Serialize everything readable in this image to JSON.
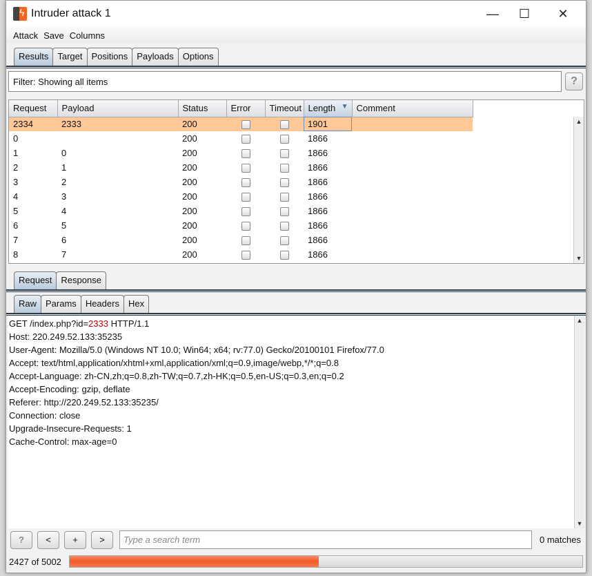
{
  "window": {
    "title": "Intruder attack 1",
    "minimize": "—",
    "maximize": "☐",
    "close": "✕"
  },
  "menu": [
    "Attack",
    "Save",
    "Columns"
  ],
  "tabs": [
    "Results",
    "Target",
    "Positions",
    "Payloads",
    "Options"
  ],
  "active_tab": "Results",
  "filter": "Filter: Showing all items",
  "help_label": "?",
  "table": {
    "columns": [
      "Request",
      "Payload",
      "Status",
      "Error",
      "Timeout",
      "Length",
      "Comment"
    ],
    "sorted_column": "Length",
    "rows": [
      [
        "2334",
        "2333",
        "200",
        false,
        false,
        "1901",
        ""
      ],
      [
        "0",
        "",
        "200",
        false,
        false,
        "1866",
        ""
      ],
      [
        "1",
        "0",
        "200",
        false,
        false,
        "1866",
        ""
      ],
      [
        "2",
        "1",
        "200",
        false,
        false,
        "1866",
        ""
      ],
      [
        "3",
        "2",
        "200",
        false,
        false,
        "1866",
        ""
      ],
      [
        "4",
        "3",
        "200",
        false,
        false,
        "1866",
        ""
      ],
      [
        "5",
        "4",
        "200",
        false,
        false,
        "1866",
        ""
      ],
      [
        "6",
        "5",
        "200",
        false,
        false,
        "1866",
        ""
      ],
      [
        "7",
        "6",
        "200",
        false,
        false,
        "1866",
        ""
      ],
      [
        "8",
        "7",
        "200",
        false,
        false,
        "1866",
        ""
      ]
    ]
  },
  "detail_tabs": [
    "Request",
    "Response"
  ],
  "view_tabs": [
    "Raw",
    "Params",
    "Headers",
    "Hex"
  ],
  "request": {
    "line_prefix": "GET /index.php?id=",
    "line_value": "2333",
    "line_suffix": " HTTP/1.1",
    "headers": [
      "Host: 220.249.52.133:35235",
      "User-Agent: Mozilla/5.0 (Windows NT 10.0; Win64; x64; rv:77.0) Gecko/20100101 Firefox/77.0",
      "Accept: text/html,application/xhtml+xml,application/xml;q=0.9,image/webp,*/*;q=0.8",
      "Accept-Language: zh-CN,zh;q=0.8,zh-TW;q=0.7,zh-HK;q=0.5,en-US;q=0.3,en;q=0.2",
      "Accept-Encoding: gzip, deflate",
      "Referer: http://220.249.52.133:35235/",
      "Connection: close",
      "Upgrade-Insecure-Requests: 1",
      "Cache-Control: max-age=0"
    ]
  },
  "search": {
    "buttons": [
      "?",
      "<",
      "+",
      ">"
    ],
    "placeholder": "Type a search term",
    "matches": "0 matches"
  },
  "progress": {
    "label": "2427 of 5002",
    "done": 2427,
    "total": 5002,
    "color": "#f05a28"
  }
}
